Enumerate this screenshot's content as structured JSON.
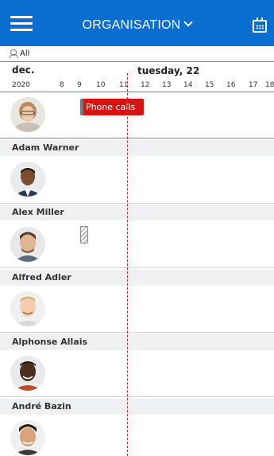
{
  "header": {
    "title": "ORGANISATION",
    "menu_icon": "hamburger-icon",
    "calendar_icon": "calendar-icon",
    "background": "#0a6dd0"
  },
  "filter": {
    "label": "All",
    "icon": "group-icon"
  },
  "timeline": {
    "month": "dec.",
    "year": "2020",
    "day_label": "tuesday, 22",
    "hours": [
      "8",
      "9",
      "10",
      "11",
      "12",
      "13",
      "14",
      "15",
      "16",
      "17",
      "18"
    ]
  },
  "events": [
    {
      "title": "Phone calls",
      "color": "#d81313"
    }
  ],
  "people": [
    {
      "name": "Adam Warner"
    },
    {
      "name": "Alex Miller"
    },
    {
      "name": "Alfred Adler"
    },
    {
      "name": "Alphonse Allais"
    },
    {
      "name": "André Bazin"
    }
  ]
}
